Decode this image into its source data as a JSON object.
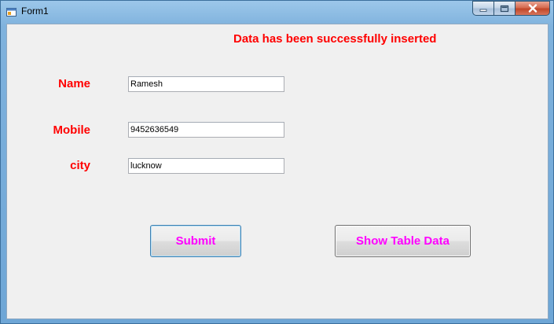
{
  "window": {
    "title": "Form1",
    "caption_icons": [
      "minimize-icon",
      "maximize-icon",
      "close-icon"
    ]
  },
  "status_message": "Data has been successfully inserted",
  "form": {
    "name_label": "Name",
    "name_value": "Ramesh",
    "mobile_label": "Mobile",
    "mobile_value": "9452636549",
    "city_label": "city",
    "city_value": "lucknow"
  },
  "buttons": {
    "submit_label": "Submit",
    "show_table_label": "Show Table Data"
  },
  "colors": {
    "label_red": "#ff0000",
    "button_text_magenta": "#ff00ff",
    "client_background": "#f0f0f0"
  }
}
